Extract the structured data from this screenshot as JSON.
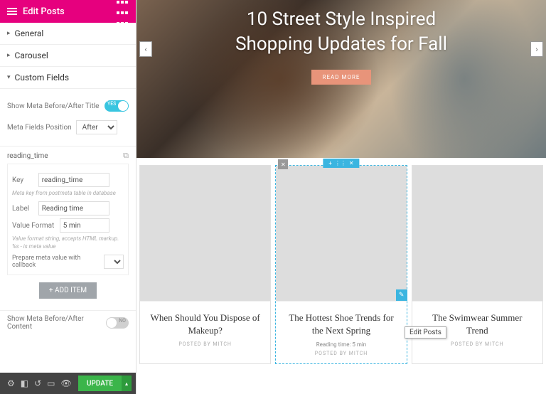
{
  "sidebar": {
    "title": "Edit Posts",
    "sections": {
      "general": "General",
      "carousel": "Carousel",
      "custom_fields": "Custom Fields"
    },
    "show_meta_title": {
      "label": "Show Meta Before/After Title",
      "toggle": "YES"
    },
    "meta_position": {
      "label": "Meta Fields Position",
      "value": "After"
    },
    "field": {
      "name": "reading_time",
      "key_label": "Key",
      "key_value": "reading_time",
      "key_hint": "Meta key from postmeta table in database",
      "label_label": "Label",
      "label_value": "Reading time",
      "vf_label": "Value Format",
      "vf_value": "5 min",
      "vf_hint": "Value format string, accepts HTML markup. %s - is meta value",
      "prepare_label": "Prepare meta value with callback"
    },
    "add_item": "+   ADD ITEM",
    "show_meta_content": {
      "label": "Show Meta Before/After Content",
      "toggle": "NO"
    },
    "update": "UPDATE"
  },
  "hero": {
    "title_l1": "10 Street Style Inspired",
    "title_l2": "Shopping Updates for Fall",
    "readmore": "READ MORE"
  },
  "cards": [
    {
      "title": "When Should You Dispose of Makeup?",
      "posted": "POSTED BY MITCH"
    },
    {
      "title": "The Hottest Shoe Trends for the Next Spring",
      "meta": "Reading time: 5 min",
      "posted": "POSTED BY MITCH"
    },
    {
      "title": "The Swimwear Summer Trend",
      "posted": "POSTED BY MITCH"
    }
  ],
  "tooltip": "Edit Posts"
}
